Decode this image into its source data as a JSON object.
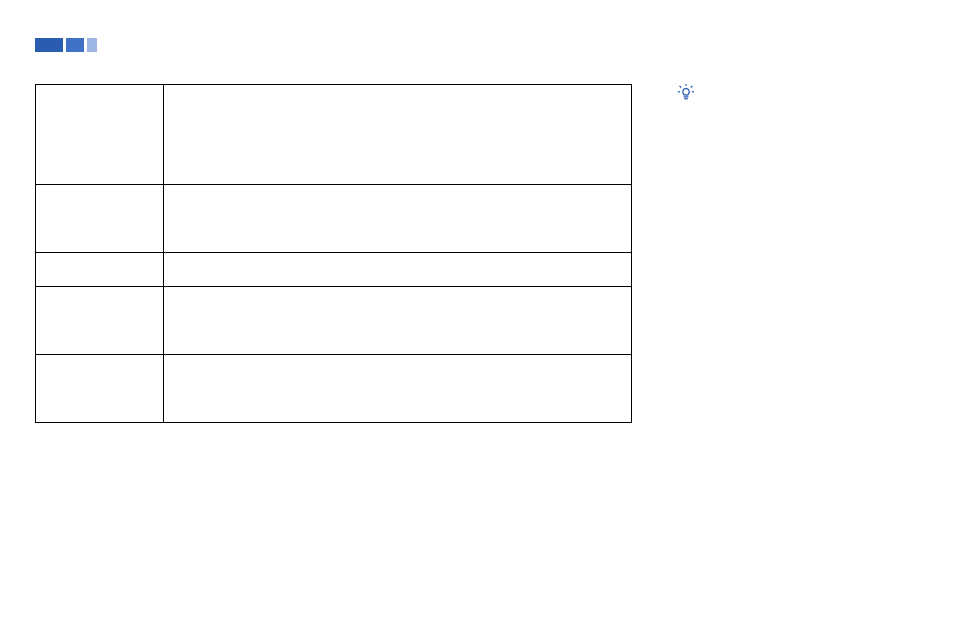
{
  "ornament": {
    "colors": [
      "#2a5db0",
      "#3f72c4",
      "#9db6e4"
    ]
  },
  "table": {
    "rows": [
      {
        "key": "",
        "value": ""
      },
      {
        "key": "",
        "value": ""
      },
      {
        "key": "",
        "value": ""
      },
      {
        "key": "",
        "value": ""
      },
      {
        "key": "",
        "value": ""
      }
    ]
  },
  "tip": {
    "icon": "lightbulb-icon"
  }
}
